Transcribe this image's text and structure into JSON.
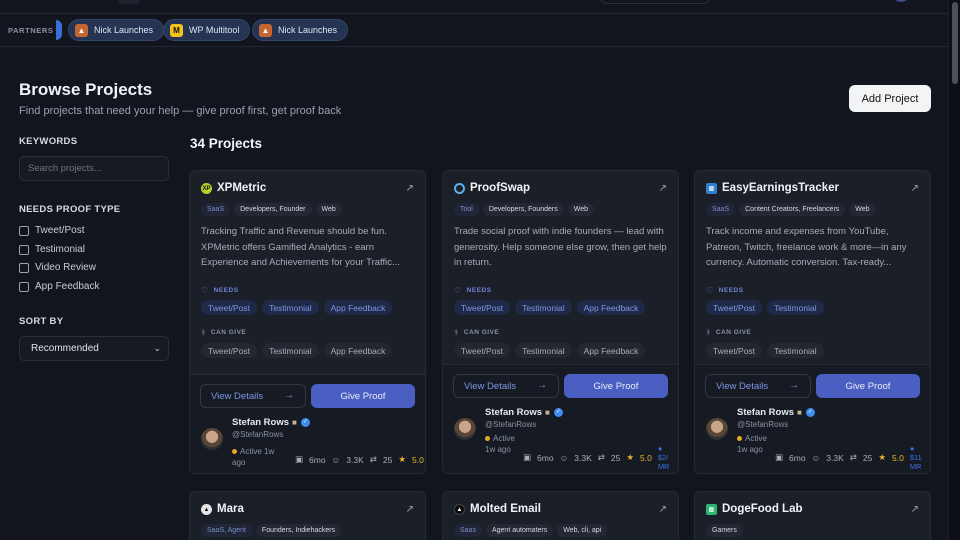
{
  "partners": {
    "label": "PARTNERS",
    "items": [
      {
        "name": "Nick Launches",
        "icon": "fox-icon"
      },
      {
        "name": "WP Multitool",
        "icon": "m-logo-icon"
      },
      {
        "name": "Nick Launches",
        "icon": "fox-icon"
      }
    ]
  },
  "page": {
    "title": "Browse Projects",
    "subtitle": "Find projects that need your help — give proof first, get proof back",
    "add_button": "Add Project",
    "count_label": "34 Projects"
  },
  "filters": {
    "keywords_label": "KEYWORDS",
    "search_placeholder": "Search projects...",
    "proof_type_label": "NEEDS PROOF TYPE",
    "proof_types": [
      "Tweet/Post",
      "Testimonial",
      "Video Review",
      "App Feedback"
    ],
    "sort_label": "SORT BY",
    "sort_value": "Recommended"
  },
  "labels": {
    "needs": "NEEDS",
    "can_give": "CAN GIVE",
    "view_details": "View Details",
    "give_proof": "Give Proof"
  },
  "projects": [
    {
      "name": "XPMetric",
      "category": "SaaS",
      "tags": [
        "Developers, Founder",
        "Web"
      ],
      "description": "Tracking Traffic and Revenue should be fun. XPMetric offers Gamified Analytics - earn Experience and Achievements for your Traffic...",
      "needs": [
        "Tweet/Post",
        "Testimonial",
        "App Feedback"
      ],
      "can_give": [
        "Tweet/Post",
        "Testimonial",
        "App Feedback"
      ],
      "owner": {
        "name": "Stefan Rows",
        "handle": "@StefanRows",
        "active": "Active 1w ago"
      },
      "stats": {
        "age": "6mo",
        "followers": "3.3K",
        "swaps": "25",
        "rating": "5.0"
      }
    },
    {
      "name": "ProofSwap",
      "category": "Tool",
      "tags": [
        "Developers, Founders",
        "Web"
      ],
      "description": "Trade social proof with indie founders — lead with generosity. Help someone else grow, then get help in return.",
      "needs": [
        "Tweet/Post",
        "Testimonial",
        "App Feedback"
      ],
      "can_give": [
        "Tweet/Post",
        "Testimonial",
        "App Feedback"
      ],
      "owner": {
        "name": "Stefan Rows",
        "handle": "@StefanRows",
        "active": "Active 1w ago"
      },
      "stats": {
        "age": "6mo",
        "followers": "3.3K",
        "swaps": "25",
        "rating": "5.0",
        "revenue": "$2/ MR"
      }
    },
    {
      "name": "EasyEarningsTracker",
      "category": "SaaS",
      "tags": [
        "Content Creators, Freelancers",
        "Web"
      ],
      "description": "Track income and expenses from YouTube, Patreon, Twitch, freelance work & more—in any currency. Automatic conversion. Tax-ready...",
      "needs": [
        "Tweet/Post",
        "Testimonial"
      ],
      "can_give": [
        "Tweet/Post",
        "Testimonial"
      ],
      "owner": {
        "name": "Stefan Rows",
        "handle": "@StefanRows",
        "active": "Active 1w ago"
      },
      "stats": {
        "age": "6mo",
        "followers": "3.3K",
        "swaps": "25",
        "rating": "5.0",
        "revenue": "$11 MR"
      }
    },
    {
      "name": "Mara",
      "category": "SaaS, Agent",
      "tags": [
        "Founders, Indiehackers"
      ]
    },
    {
      "name": "Molted Email",
      "category": "Saas",
      "tags": [
        "Agent automaters",
        "Web, cli, api"
      ]
    },
    {
      "name": "DogeFood Lab",
      "category": "",
      "tags": [
        "Gamers"
      ]
    }
  ]
}
